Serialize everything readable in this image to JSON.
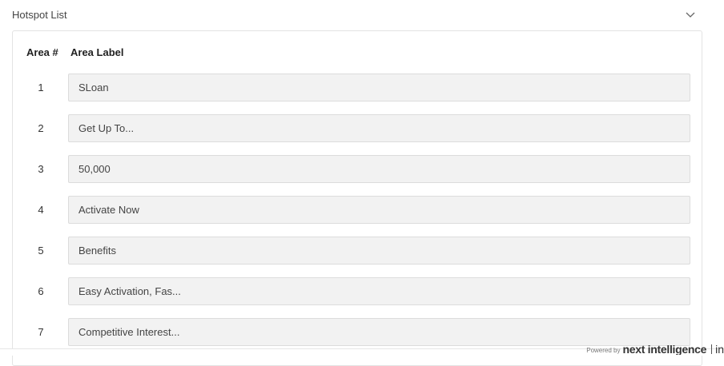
{
  "section": {
    "title": "Hotspot List"
  },
  "table": {
    "headers": {
      "area_number": "Area #",
      "area_label": "Area Label"
    },
    "rows": [
      {
        "number": "1",
        "label": "SLoan"
      },
      {
        "number": "2",
        "label": "Get Up To..."
      },
      {
        "number": "3",
        "label": "50,000"
      },
      {
        "number": "4",
        "label": "Activate Now"
      },
      {
        "number": "5",
        "label": "Benefits"
      },
      {
        "number": "6",
        "label": "Easy Activation, Fas..."
      },
      {
        "number": "7",
        "label": "Competitive Interest..."
      }
    ]
  },
  "footer": {
    "powered_by": "Powered by",
    "brand": "next intelligence",
    "brand_tail": "in"
  },
  "icons": {
    "collapse": "chevron-down-icon"
  },
  "colors": {
    "input_background": "#f2f2f2",
    "input_border": "#dcdcdc",
    "panel_border": "#e3e3e3"
  }
}
